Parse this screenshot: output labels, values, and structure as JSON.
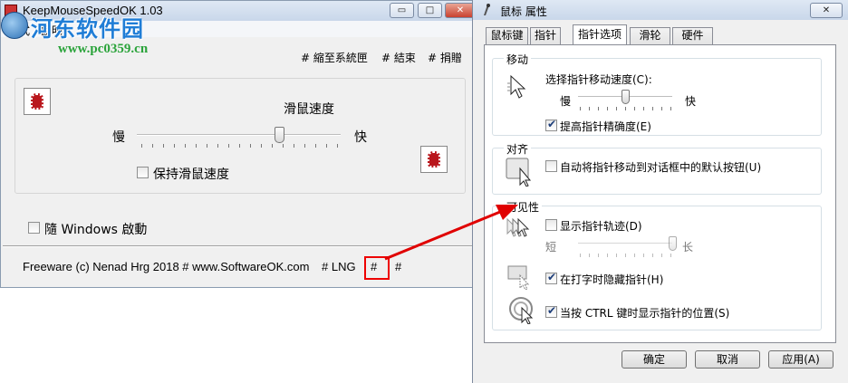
{
  "watermark": {
    "cn": "河东软件园",
    "url": "www.pc0359.cn"
  },
  "kms": {
    "title": "KeepMouseSpeedOK 1.03",
    "menu": [
      "程式",
      "說明"
    ],
    "top_links": [
      "# 縮至系統匣",
      "# 結束",
      "# 捐贈"
    ],
    "speed_label": "滑鼠速度",
    "slow": "慢",
    "fast": "快",
    "speed_value_percent": 70,
    "keep_speed_label": "保持滑鼠速度",
    "keep_speed_checked": false,
    "autostart_label": "隨 Windows 啟動",
    "autostart_checked": false,
    "footer": {
      "copyright": "Freeware (c) Nenad Hrg 2018 # www.SoftwareOK.com",
      "lng": "# LNG",
      "hash1": "#",
      "hash2": "#"
    },
    "caption_buttons": {
      "minimize": "▭",
      "maximize": "□",
      "close": "✕"
    }
  },
  "mp": {
    "title": "鼠标 属性",
    "close": "✕",
    "tabs": [
      "鼠标键",
      "指针",
      "指针选项",
      "滑轮",
      "硬件"
    ],
    "active_tab": 2,
    "motion": {
      "title": "移动",
      "speed_label": "选择指针移动速度(C):",
      "slow": "慢",
      "fast": "快",
      "speed_value_percent": 50,
      "enhance_label": "提高指针精确度(E)",
      "enhance_checked": true
    },
    "snap": {
      "title": "对齐",
      "label": "自动将指针移动到对话框中的默认按钮(U)",
      "checked": false
    },
    "visibility": {
      "title": "可见性",
      "trails_label": "显示指针轨迹(D)",
      "trails_checked": false,
      "short": "短",
      "long": "长",
      "trails_value_percent": 100,
      "hide_label": "在打字时隐藏指针(H)",
      "hide_checked": true,
      "ctrl_label": "当按 CTRL 键时显示指针的位置(S)",
      "ctrl_checked": true
    },
    "buttons": {
      "ok": "确定",
      "cancel": "取消",
      "apply": "应用(A)"
    }
  },
  "colors": {
    "annotation_red": "#e00000",
    "watermark_blue": "#1f7dd6",
    "watermark_green": "#2aa33a"
  }
}
